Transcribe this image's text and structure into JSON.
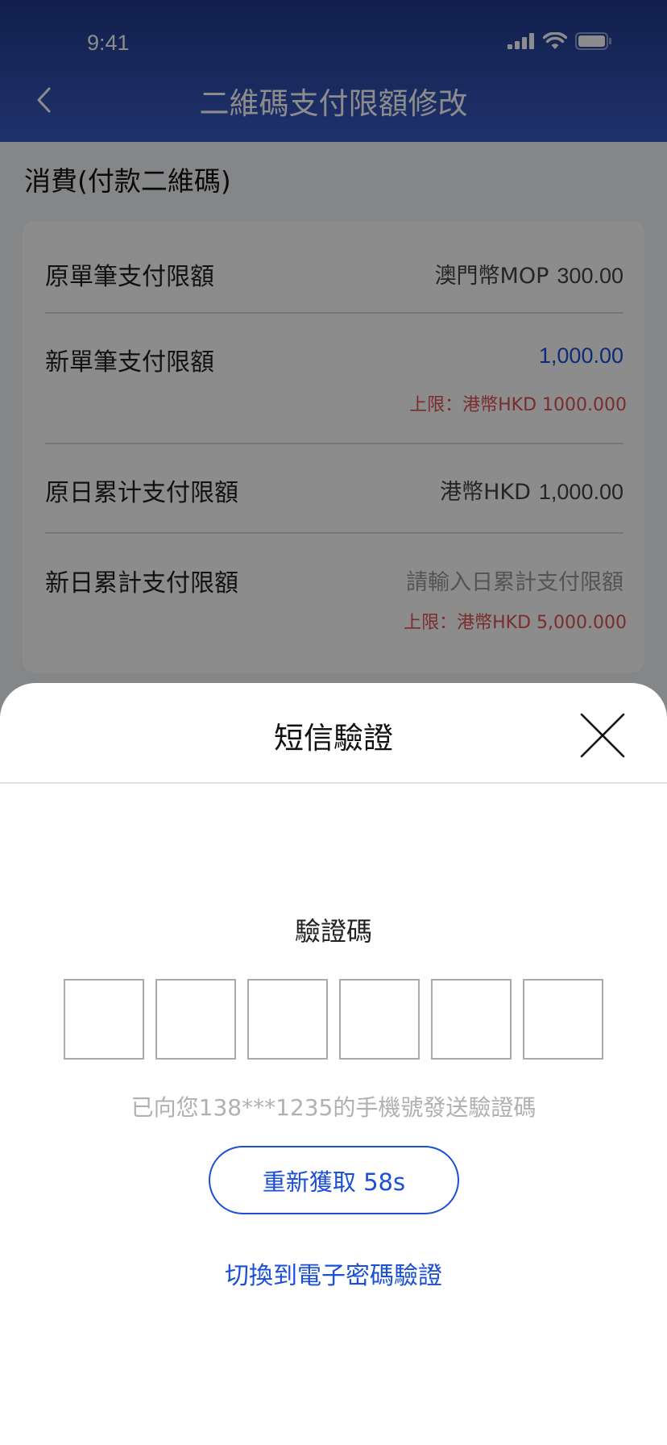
{
  "status_bar": {
    "time": "9:41"
  },
  "nav": {
    "title": "二維碼支付限額修改"
  },
  "section": {
    "title": "消費(付款二維碼)"
  },
  "limits": {
    "orig_single": {
      "label": "原單筆支付限額",
      "currency": "澳門幣MOP",
      "amount": "300.00"
    },
    "new_single": {
      "label": "新單筆支付限額",
      "value": "1,000.00",
      "limit_note": "上限：港幣HKD 1000.000"
    },
    "orig_daily": {
      "label": "原日累计支付限額",
      "currency": "港幣HKD",
      "amount": "1,000.00"
    },
    "new_daily": {
      "label": "新日累計支付限額",
      "placeholder": "請輸入日累計支付限額",
      "limit_note": "上限：港幣HKD 5,000.000"
    }
  },
  "sms_sheet": {
    "title": "短信驗證",
    "code_label": "驗證碼",
    "code_digits": [
      "",
      "",
      "",
      "",
      "",
      ""
    ],
    "hint": "已向您138***1235的手機號發送驗證碼",
    "resend_label": "重新獲取  58s",
    "switch_link": "切換到電子密碼驗證"
  },
  "colors": {
    "header_top": "#1f3a8c",
    "accent_blue": "#1a4fd6",
    "limit_red": "#e05050"
  }
}
